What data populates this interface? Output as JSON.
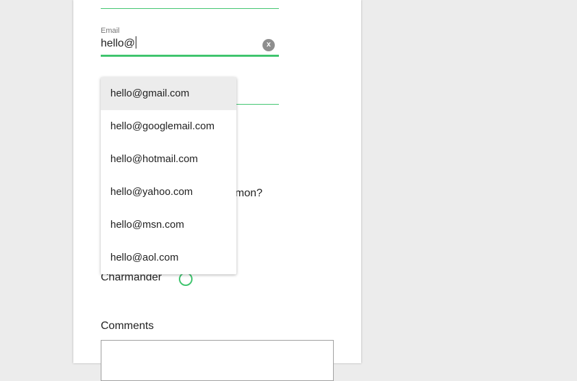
{
  "form": {
    "email": {
      "label": "Email",
      "value": "hello@",
      "clear_label": "x"
    },
    "question_fragment": "mon?",
    "radio_option": "Charmander",
    "comments_label": "Comments"
  },
  "autocomplete": {
    "items": [
      "hello@gmail.com",
      "hello@googlemail.com",
      "hello@hotmail.com",
      "hello@yahoo.com",
      "hello@msn.com",
      "hello@aol.com"
    ],
    "highlighted_index": 0
  },
  "colors": {
    "accent": "#3ec46d",
    "background": "#ececec",
    "highlight": "#ececec"
  }
}
